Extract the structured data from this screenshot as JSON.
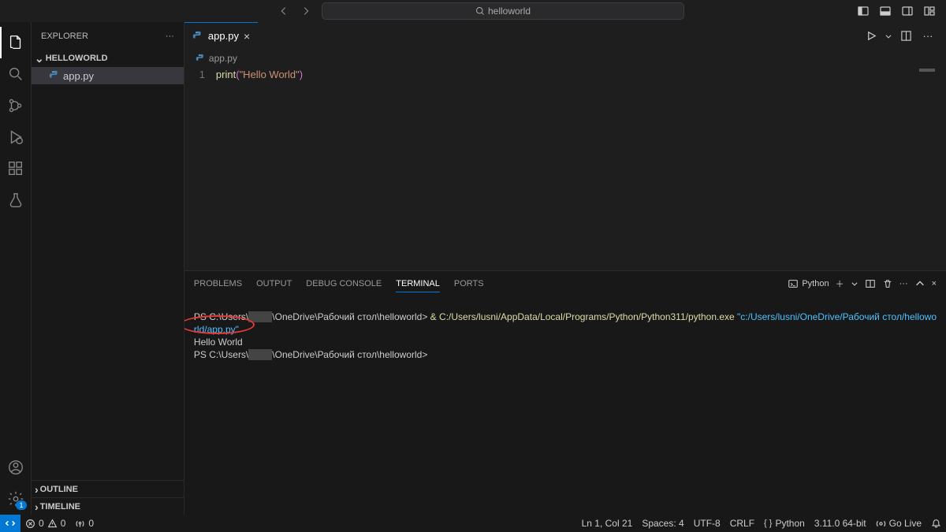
{
  "search": {
    "placeholder": "helloworld"
  },
  "activity": {
    "manageBadge": "1"
  },
  "sidebar": {
    "title": "EXPLORER",
    "folder": "HELLOWORLD",
    "file": "app.py",
    "outline": "OUTLINE",
    "timeline": "TIMELINE"
  },
  "tab": {
    "name": "app.py"
  },
  "breadcrumb": {
    "file": "app.py"
  },
  "code": {
    "lineNum": "1",
    "fn": "print",
    "open": "(",
    "str": "\"Hello World\"",
    "close": ")"
  },
  "panel": {
    "tabs": {
      "problems": "PROBLEMS",
      "output": "OUTPUT",
      "debug": "DEBUG CONSOLE",
      "terminal": "TERMINAL",
      "ports": "PORTS"
    },
    "shell": "Python"
  },
  "terminal": {
    "line1a": "PS C:\\Users\\",
    "line1b": "\\OneDrive\\Рабочий стол\\helloworld> ",
    "line1amp": "&",
    "line1py": " C:/Users/lusni/AppData/Local/Programs/Python/Python311/python.exe ",
    "line1arg": "\"c:/Users/lusni/OneDrive/Рабочий стол/hellowo",
    "line2": "rld/app.py\"",
    "line3": "Hello World",
    "line4a": "PS C:\\Users\\",
    "line4b": "\\OneDrive\\Рабочий стол\\helloworld> "
  },
  "status": {
    "errors": "0",
    "warnings": "0",
    "ports": "0",
    "lncol": "Ln 1, Col 21",
    "spaces": "Spaces: 4",
    "enc": "UTF-8",
    "eol": "CRLF",
    "lang": "Python",
    "py": "3.11.0 64-bit",
    "golive": "Go Live"
  }
}
